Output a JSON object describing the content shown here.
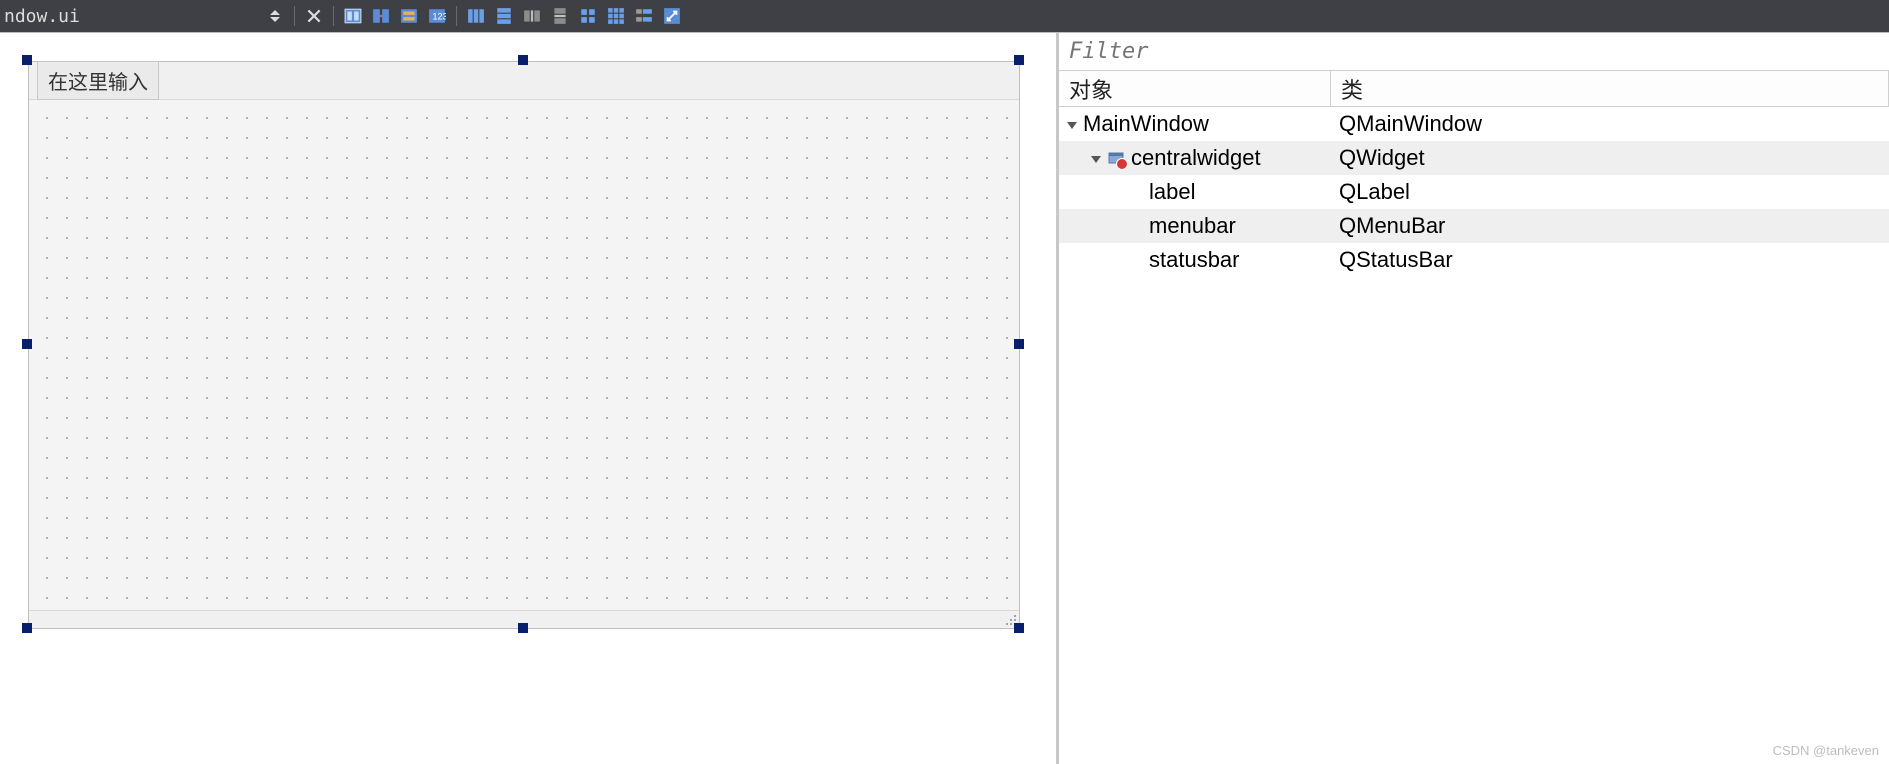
{
  "toolbar": {
    "file_label": "ndow.ui"
  },
  "designer": {
    "menu_placeholder": "在这里输入"
  },
  "inspector": {
    "filter_placeholder": "Filter",
    "columns": {
      "object": "对象",
      "class": "类"
    },
    "rows": [
      {
        "indent": 0,
        "expander": true,
        "icon": "window",
        "name": "MainWindow",
        "class": "QMainWindow",
        "alt": false
      },
      {
        "indent": 1,
        "expander": true,
        "icon": "widget",
        "name": "centralwidget",
        "class": "QWidget",
        "alt": true
      },
      {
        "indent": 2,
        "expander": false,
        "icon": "none",
        "name": "label",
        "class": "QLabel",
        "alt": false
      },
      {
        "indent": 2,
        "expander": false,
        "icon": "none",
        "name": "menubar",
        "class": "QMenuBar",
        "alt": true
      },
      {
        "indent": 2,
        "expander": false,
        "icon": "none",
        "name": "statusbar",
        "class": "QStatusBar",
        "alt": false
      }
    ]
  },
  "watermark": "CSDN @tankeven"
}
